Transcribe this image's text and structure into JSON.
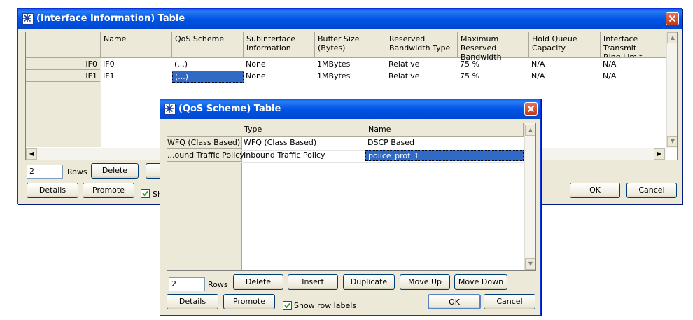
{
  "interface_window": {
    "title": "(Interface Information) Table",
    "columns": [
      "Name",
      "QoS Scheme",
      "Subinterface\nInformation",
      "Buffer Size (Bytes)",
      "Reserved\nBandwidth Type",
      "Maximum Reserved\nBandwidth",
      "Hold Queue\nCapacity",
      "Interface Transmit\nRing Limit"
    ],
    "rows": [
      {
        "label": "IF0",
        "cells": [
          "IF0",
          "(...)",
          "None",
          "1MBytes",
          "Relative",
          "75 %",
          "N/A",
          "N/A"
        ]
      },
      {
        "label": "IF1",
        "cells": [
          "IF1",
          "(...)",
          "None",
          "1MBytes",
          "Relative",
          "75 %",
          "N/A",
          "N/A"
        ]
      }
    ],
    "rows_value": "2",
    "rows_label": "Rows",
    "delete_label": "Delete",
    "details_label": "Details",
    "promote_label": "Promote",
    "show_row_labels_partial": "Sh",
    "ok_label": "OK",
    "cancel_label": "Cancel"
  },
  "qos_window": {
    "title": "(QoS Scheme) Table",
    "columns": [
      "Type",
      "Name"
    ],
    "rows": [
      {
        "label": "WFQ (Class Based)",
        "cells": [
          "WFQ (Class Based)",
          "DSCP Based"
        ]
      },
      {
        "label": "...ound Traffic Policy",
        "cells": [
          "Inbound Traffic Policy",
          "police_prof_1"
        ]
      }
    ],
    "rows_value": "2",
    "rows_label": "Rows",
    "delete_label": "Delete",
    "insert_label": "Insert",
    "duplicate_label": "Duplicate",
    "move_up_label": "Move Up",
    "move_down_label": "Move Down",
    "details_label": "Details",
    "promote_label": "Promote",
    "show_row_labels": "Show row labels",
    "show_row_labels_checked": true,
    "ok_label": "OK",
    "cancel_label": "Cancel"
  }
}
